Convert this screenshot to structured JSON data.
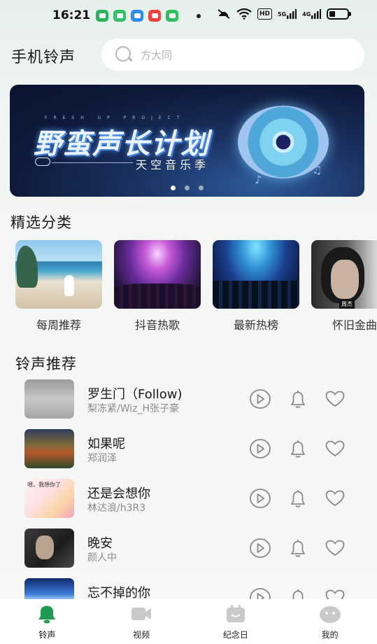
{
  "status_bar": {
    "time": "16:21",
    "app_icons": [
      {
        "name": "app-icon-1",
        "color": "#27b35b"
      },
      {
        "name": "app-icon-2",
        "color": "#35c06a"
      },
      {
        "name": "app-icon-3",
        "color": "#2d8cf0"
      },
      {
        "name": "app-icon-4",
        "color": "#f0413c"
      },
      {
        "name": "app-icon-5",
        "color": "#2fbf5b"
      }
    ],
    "hd": "HD",
    "network_5g": "5G",
    "network_4g": "4G"
  },
  "header": {
    "title": "手机铃声",
    "search_placeholder": "方大同"
  },
  "banner": {
    "top_caption": "FRESH UP PROJECT",
    "title": "野蛮声长计划",
    "subtitle": "天空音乐季",
    "dots": 3,
    "active_dot": 0
  },
  "featured": {
    "section_title": "精选分类",
    "categories": [
      {
        "label": "每周推荐"
      },
      {
        "label": "抖音热歌"
      },
      {
        "label": "最新热榜"
      },
      {
        "label": "怀旧金曲",
        "image_tag": "周杰"
      }
    ]
  },
  "ringtones": {
    "section_title": "铃声推荐",
    "items": [
      {
        "title": "罗生门（Follow)",
        "artist": "梨冻紧/Wiz_H张子豪"
      },
      {
        "title": "如果呢",
        "artist": "郑润泽"
      },
      {
        "title": "还是会想你",
        "artist": "林达浪/h3R3",
        "cover_text": "喂，我想你了"
      },
      {
        "title": "晚安",
        "artist": "颜人中"
      },
      {
        "title": "忘不掉的你",
        "artist": ""
      }
    ]
  },
  "bottom_nav": {
    "items": [
      {
        "label": "铃声",
        "icon": "bell-icon",
        "active": true
      },
      {
        "label": "视频",
        "icon": "video-camera-icon",
        "active": false
      },
      {
        "label": "纪念日",
        "icon": "calendar-icon",
        "active": false
      },
      {
        "label": "我的",
        "icon": "profile-icon",
        "active": false
      }
    ],
    "active_color": "#1f9a53",
    "inactive_color": "#c9c9c9"
  }
}
